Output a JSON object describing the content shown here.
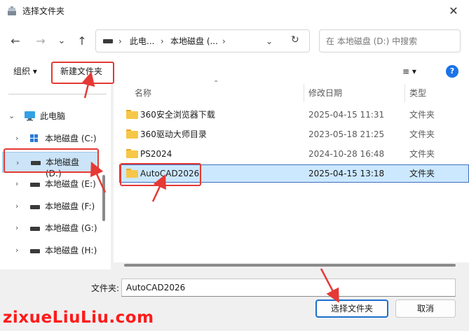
{
  "window": {
    "title": "选择文件夹",
    "close_glyph": "✕"
  },
  "nav": {
    "back_glyph": "←",
    "forward_glyph": "→",
    "recent_glyph": "⌄",
    "up_glyph": "↑",
    "refresh_glyph": "↻"
  },
  "address": {
    "segments": [
      "此电...",
      "本地磁盘 (..."
    ],
    "chevron_glyph": "›",
    "dropdown_glyph": "⌄"
  },
  "search": {
    "placeholder": "在 本地磁盘 (D:) 中搜索"
  },
  "toolbar": {
    "organize_label": "组织 ▾",
    "new_folder_label": "新建文件夹",
    "view_glyph": "≡ ▾",
    "help_glyph": "?"
  },
  "sidebar": {
    "root_label": "此电脑",
    "items": [
      {
        "label": "本地磁盘 (C:)"
      },
      {
        "label": "本地磁盘 (D:)"
      },
      {
        "label": "本地磁盘 (E:)"
      },
      {
        "label": "本地磁盘 (F:)"
      },
      {
        "label": "本地磁盘 (G:)"
      },
      {
        "label": "本地磁盘 (H:)"
      }
    ]
  },
  "columns": {
    "name": "名称",
    "date": "修改日期",
    "type": "类型",
    "sort_glyph": "⌃"
  },
  "files": [
    {
      "name": "360安全浏览器下载",
      "date": "2025-04-15 11:31",
      "type": "文件夹"
    },
    {
      "name": "360驱动大师目录",
      "date": "2023-05-18 21:25",
      "type": "文件夹"
    },
    {
      "name": "PS2024",
      "date": "2024-10-28 16:48",
      "type": "文件夹"
    },
    {
      "name": "AutoCAD2026",
      "date": "2025-04-15 13:18",
      "type": "文件夹"
    }
  ],
  "footer": {
    "folder_label": "文件夹:",
    "folder_value": "AutoCAD2026",
    "select_button": "选择文件夹",
    "cancel_button": "取消"
  },
  "watermark": {
    "text": "zixueLiuLiu.com"
  },
  "colors": {
    "accent": "#1b6fd0",
    "annotation": "#e53935",
    "selection": "#cce8ff",
    "folder": "#f7c748"
  }
}
